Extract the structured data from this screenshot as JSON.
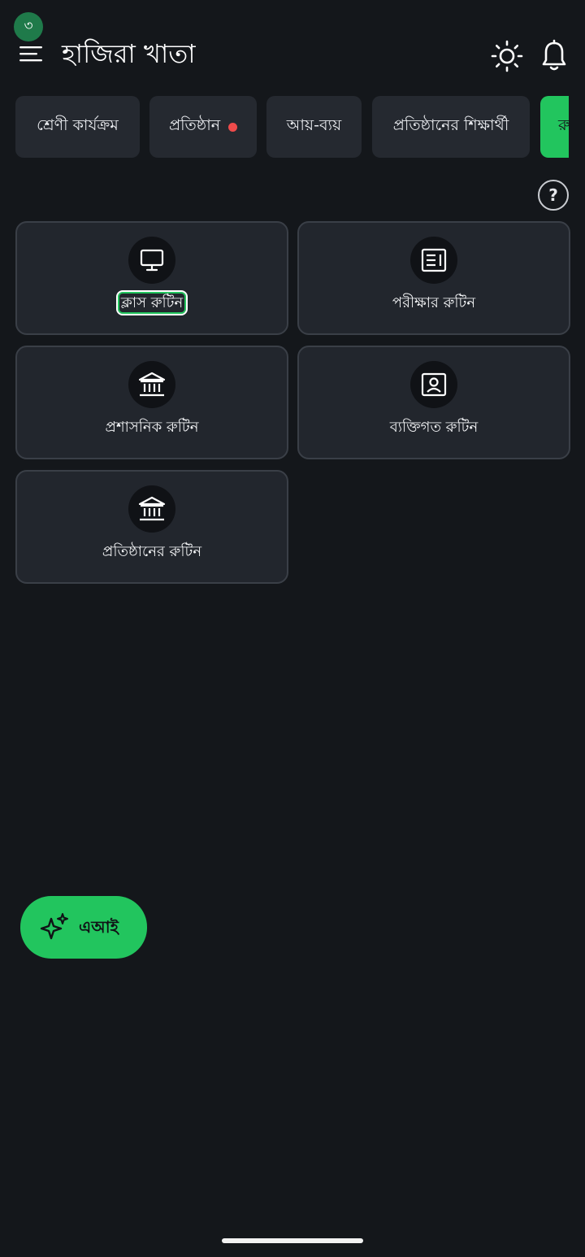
{
  "status": {
    "notification_count": "৩"
  },
  "header": {
    "title": "হাজিরা খাতা",
    "menu_icon": "hamburger-menu-icon",
    "theme_icon": "sun-icon",
    "bell_icon": "bell-icon"
  },
  "tabs": [
    {
      "label": "শ্রেণী কার্যক্রম",
      "has_dot": false
    },
    {
      "label": "প্রতিষ্ঠান",
      "has_dot": true
    },
    {
      "label": "আয়-ব্যয়",
      "has_dot": false
    },
    {
      "label": "প্রতিষ্ঠানের শিক্ষার্থী",
      "has_dot": false
    },
    {
      "label": "রু",
      "active": true
    }
  ],
  "help": {
    "label": "?"
  },
  "cards": [
    {
      "label": "ক্লাস রুটিন",
      "icon": "monitor-icon",
      "focused": true
    },
    {
      "label": "পরীক্ষার রুটিন",
      "icon": "newspaper-icon"
    },
    {
      "label": "প্রশাসনিক রুটিন",
      "icon": "bank-building-icon"
    },
    {
      "label": "ব্যক্তিগত রুটিন",
      "icon": "person-card-icon"
    },
    {
      "label": "প্রতিষ্ঠানের রুটিন",
      "icon": "bank-building-icon"
    }
  ],
  "fab": {
    "label": "এআই",
    "icon": "sparkle-icon"
  },
  "colors": {
    "background": "#14171b",
    "surface": "#22262d",
    "accent": "#22c55e",
    "badge": "#1f7a4a",
    "dot": "#ef4b4b"
  }
}
